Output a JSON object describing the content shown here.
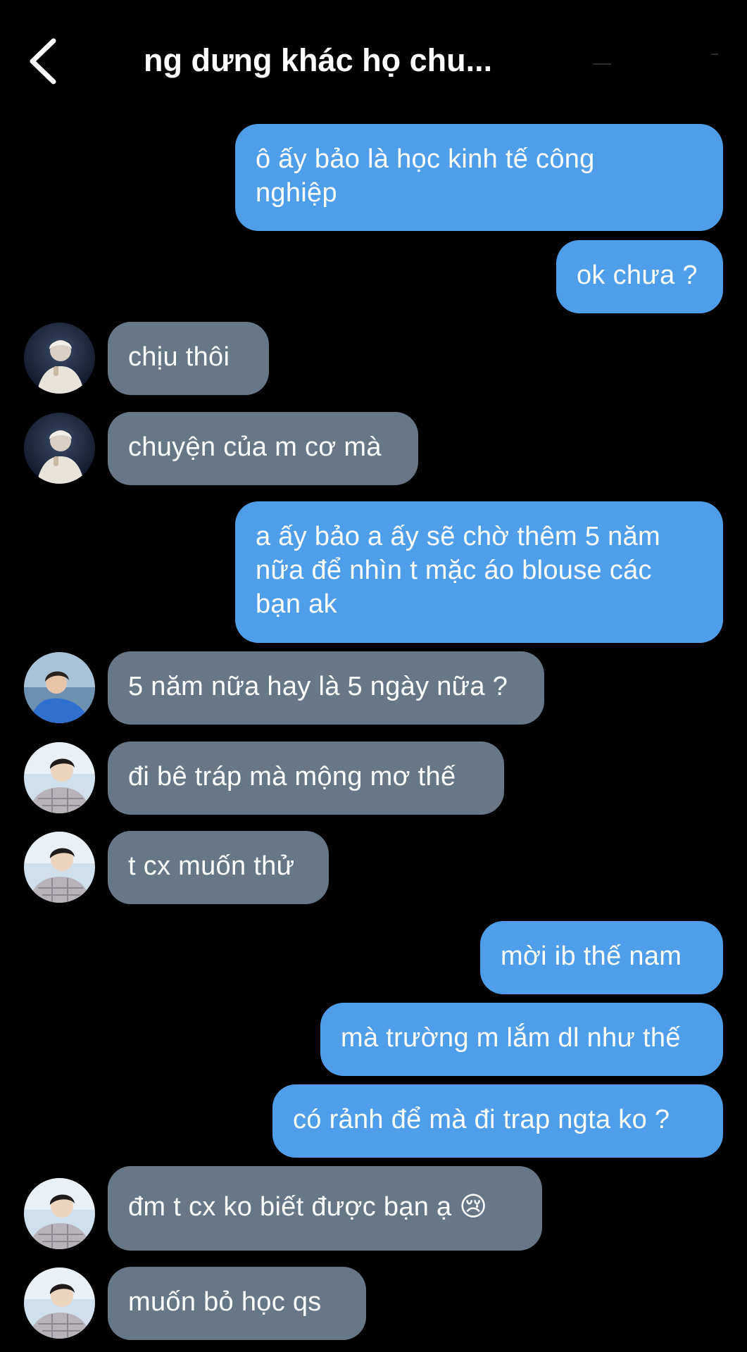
{
  "header": {
    "title": "ng dưng khác họ chu...",
    "back_icon": "chevron-left-icon"
  },
  "colors": {
    "background": "#000000",
    "outgoing_bubble": "#4f9ee9",
    "incoming_bubble": "#687787",
    "text": "#ffffff"
  },
  "messages": [
    {
      "direction": "out",
      "text": "ô ấy bảo là học kinh tế công\nnghiệp"
    },
    {
      "direction": "out",
      "text": "ok chưa ?"
    },
    {
      "direction": "in",
      "avatar": "avatar-white-hair",
      "text": "chịu thôi"
    },
    {
      "direction": "in",
      "avatar": "avatar-white-hair",
      "text": "chuyện của m cơ mà"
    },
    {
      "direction": "out",
      "text": "a ấy bảo a ấy sẽ chờ thêm 5 năm\nnữa để nhìn t mặc áo blouse các\nbạn ak"
    },
    {
      "direction": "in",
      "avatar": "avatar-blue-shirt",
      "text": "5 năm nữa hay là 5 ngày nữa ?"
    },
    {
      "direction": "in",
      "avatar": "avatar-plaid-shirt",
      "text": "đi bê tráp mà mộng mơ thế"
    },
    {
      "direction": "in",
      "avatar": "avatar-plaid-shirt",
      "text": "t cx muốn thử"
    },
    {
      "direction": "out",
      "text": "mời ib thế nam"
    },
    {
      "direction": "out",
      "text": "mà trường m lắm dl như thế"
    },
    {
      "direction": "out",
      "text": "có rảnh để mà đi trap ngta ko ?"
    },
    {
      "direction": "in",
      "avatar": "avatar-plaid-shirt",
      "text": "đm t cx ko biết được bạn ạ 😢"
    },
    {
      "direction": "in",
      "avatar": "avatar-plaid-shirt",
      "text": "muốn bỏ học qs"
    }
  ]
}
